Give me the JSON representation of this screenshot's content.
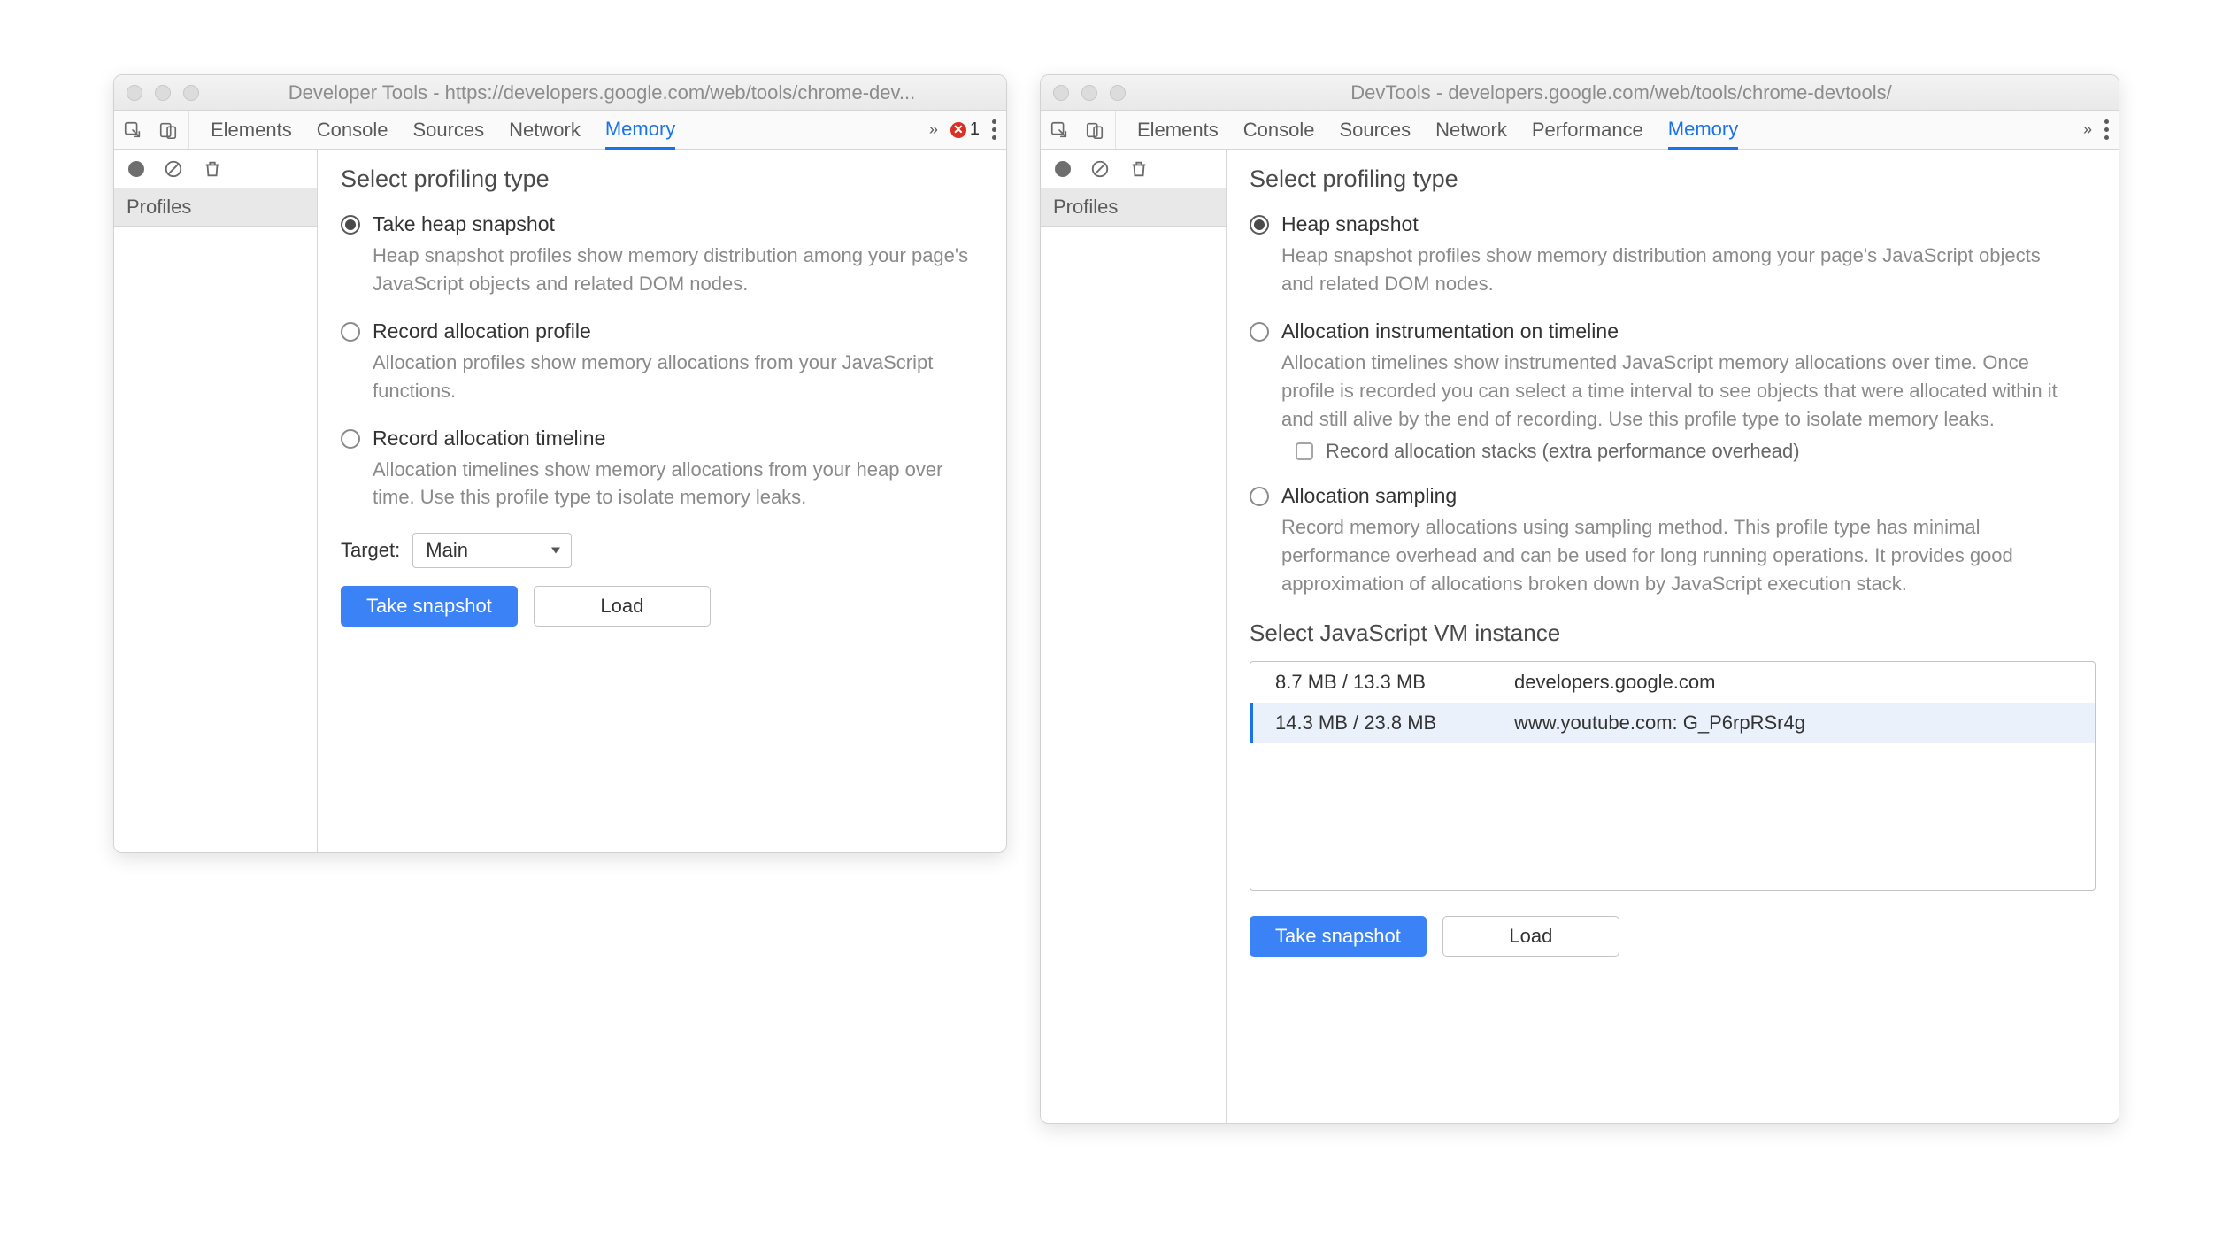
{
  "left": {
    "title": "Developer Tools - https://developers.google.com/web/tools/chrome-dev...",
    "tabs": [
      "Elements",
      "Console",
      "Sources",
      "Network",
      "Memory"
    ],
    "active_tab": "Memory",
    "error_count": "1",
    "sidebar_header": "Profiles",
    "heading": "Select profiling type",
    "options": [
      {
        "label": "Take heap snapshot",
        "desc": "Heap snapshot profiles show memory distribution among your page's JavaScript objects and related DOM nodes.",
        "selected": true
      },
      {
        "label": "Record allocation profile",
        "desc": "Allocation profiles show memory allocations from your JavaScript functions.",
        "selected": false
      },
      {
        "label": "Record allocation timeline",
        "desc": "Allocation timelines show memory allocations from your heap over time. Use this profile type to isolate memory leaks.",
        "selected": false
      }
    ],
    "target_label": "Target:",
    "target_value": "Main",
    "buttons": {
      "primary": "Take snapshot",
      "secondary": "Load"
    }
  },
  "right": {
    "title": "DevTools - developers.google.com/web/tools/chrome-devtools/",
    "tabs": [
      "Elements",
      "Console",
      "Sources",
      "Network",
      "Performance",
      "Memory"
    ],
    "active_tab": "Memory",
    "sidebar_header": "Profiles",
    "heading": "Select profiling type",
    "options": [
      {
        "label": "Heap snapshot",
        "desc": "Heap snapshot profiles show memory distribution among your page's JavaScript objects and related DOM nodes.",
        "selected": true
      },
      {
        "label": "Allocation instrumentation on timeline",
        "desc": "Allocation timelines show instrumented JavaScript memory allocations over time. Once profile is recorded you can select a time interval to see objects that were allocated within it and still alive by the end of recording. Use this profile type to isolate memory leaks.",
        "selected": false,
        "checkbox": "Record allocation stacks (extra performance overhead)"
      },
      {
        "label": "Allocation sampling",
        "desc": "Record memory allocations using sampling method. This profile type has minimal performance overhead and can be used for long running operations. It provides good approximation of allocations broken down by JavaScript execution stack.",
        "selected": false
      }
    ],
    "vm_heading": "Select JavaScript VM instance",
    "vm_rows": [
      {
        "mem": "8.7 MB / 13.3 MB",
        "origin": "developers.google.com",
        "selected": false
      },
      {
        "mem": "14.3 MB / 23.8 MB",
        "origin": "www.youtube.com: G_P6rpRSr4g",
        "selected": true
      }
    ],
    "buttons": {
      "primary": "Take snapshot",
      "secondary": "Load"
    }
  }
}
